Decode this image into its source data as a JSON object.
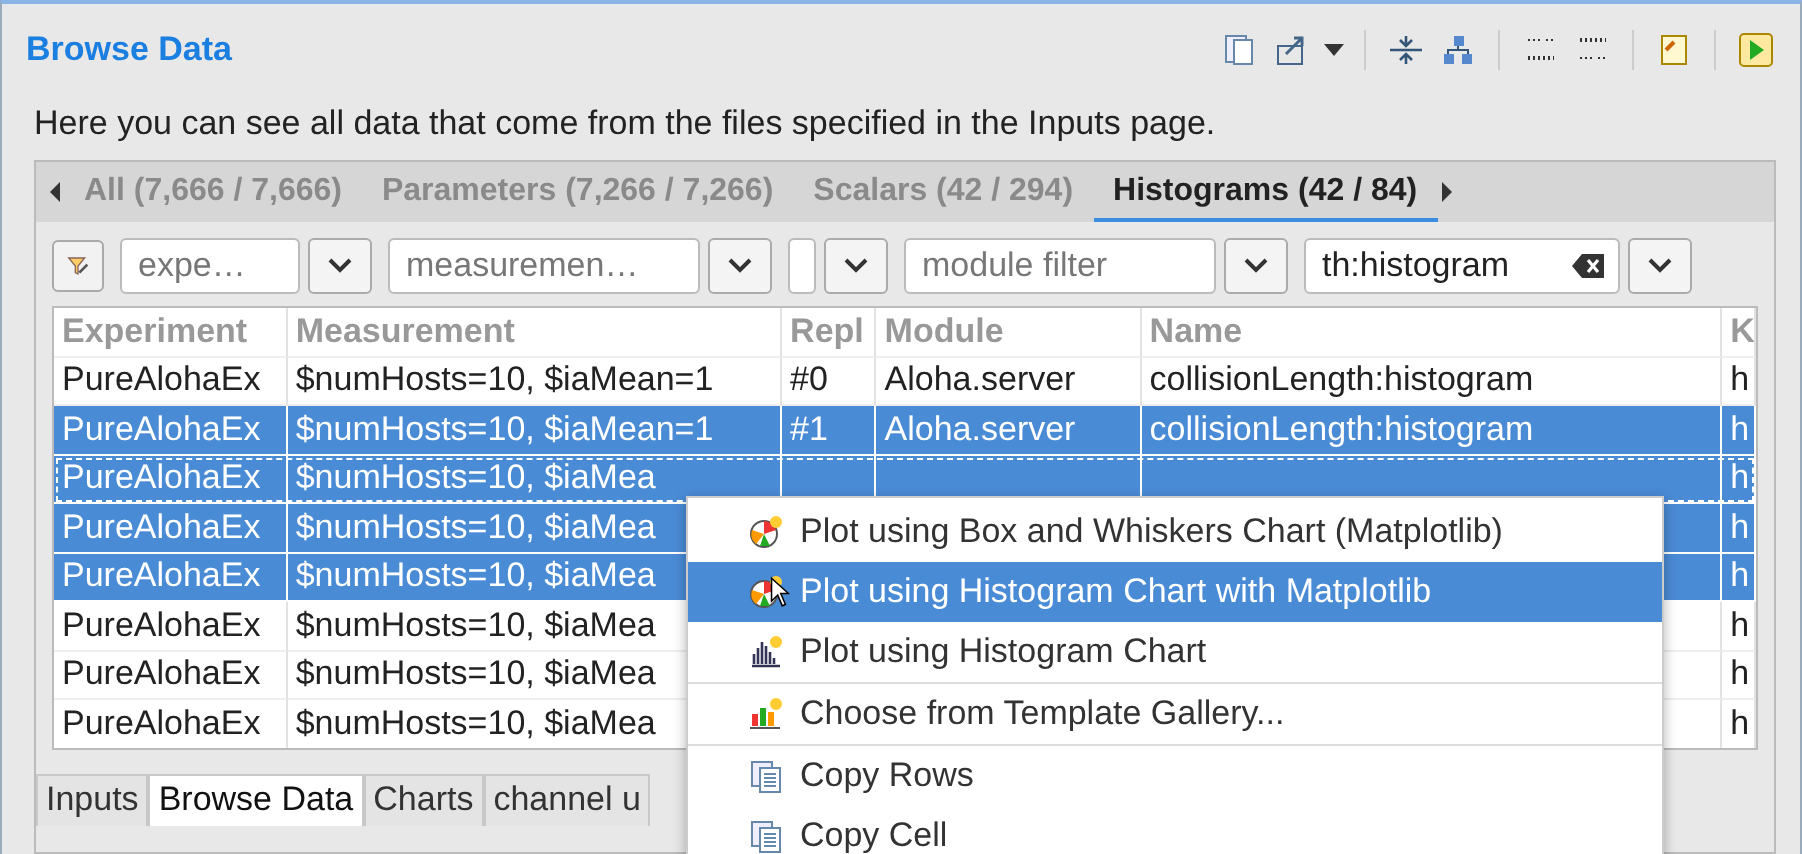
{
  "view": {
    "title": "Browse Data",
    "description": "Here you can see all data that come from the files specified in the Inputs page."
  },
  "tabs": [
    {
      "label": "All (7,666 / 7,666)",
      "selected": false
    },
    {
      "label": "Parameters (7,266 / 7,266)",
      "selected": false
    },
    {
      "label": "Scalars (42 / 294)",
      "selected": false
    },
    {
      "label": "Histograms (42 / 84)",
      "selected": true
    }
  ],
  "filters": [
    {
      "kind": "combo",
      "placeholder": "expe…"
    },
    {
      "kind": "combo",
      "placeholder": "measuremen…"
    },
    {
      "kind": "narrow"
    },
    {
      "kind": "combo",
      "placeholder": "module filter"
    },
    {
      "kind": "combo",
      "value": "th:histogram"
    }
  ],
  "table": {
    "columns": [
      "Experiment",
      "Measurement",
      "Repl",
      "Module",
      "Name",
      "K"
    ],
    "rows": [
      {
        "selected": false,
        "focused": false,
        "cells": [
          "PureAlohaEx",
          "$numHosts=10, $iaMean=1",
          "#0",
          "Aloha.server",
          "collisionLength:histogram",
          "h"
        ]
      },
      {
        "selected": true,
        "focused": false,
        "cells": [
          "PureAlohaEx",
          "$numHosts=10, $iaMean=1",
          "#1",
          "Aloha.server",
          "collisionLength:histogram",
          "h"
        ]
      },
      {
        "selected": true,
        "focused": true,
        "cells": [
          "PureAlohaEx",
          "$numHosts=10, $iaMea",
          null,
          null,
          null,
          "h"
        ]
      },
      {
        "selected": true,
        "focused": false,
        "cells": [
          "PureAlohaEx",
          "$numHosts=10, $iaMea",
          null,
          null,
          null,
          "h"
        ]
      },
      {
        "selected": true,
        "focused": false,
        "cells": [
          "PureAlohaEx",
          "$numHosts=10, $iaMea",
          null,
          null,
          null,
          "h"
        ]
      },
      {
        "selected": false,
        "focused": false,
        "cells": [
          "PureAlohaEx",
          "$numHosts=10, $iaMea",
          null,
          null,
          null,
          "h"
        ]
      },
      {
        "selected": false,
        "focused": false,
        "cells": [
          "PureAlohaEx",
          "$numHosts=10, $iaMea",
          null,
          null,
          null,
          "h"
        ]
      },
      {
        "selected": false,
        "focused": false,
        "cells": [
          "PureAlohaEx",
          "$numHosts=10, $iaMea",
          null,
          null,
          null,
          "h"
        ]
      }
    ]
  },
  "pages": [
    {
      "label": "Inputs",
      "selected": false
    },
    {
      "label": "Browse Data",
      "selected": true
    },
    {
      "label": "Charts",
      "selected": false
    },
    {
      "label": "channel u",
      "selected": false
    }
  ],
  "context_menu": {
    "groups": [
      [
        {
          "kind": "matplotlib",
          "label": "Plot using Box and Whiskers Chart (Matplotlib)",
          "selected": false
        },
        {
          "kind": "matplotlib",
          "label": "Plot using Histogram Chart with Matplotlib",
          "selected": true
        },
        {
          "kind": "histogram",
          "label": "Plot using Histogram Chart",
          "selected": false
        }
      ],
      [
        {
          "kind": "gallery",
          "label": "Choose from Template Gallery...",
          "selected": false
        }
      ],
      [
        {
          "kind": "copy",
          "label": "Copy Rows",
          "selected": false
        },
        {
          "kind": "copy",
          "label": "Copy Cell",
          "selected": false
        }
      ]
    ]
  }
}
